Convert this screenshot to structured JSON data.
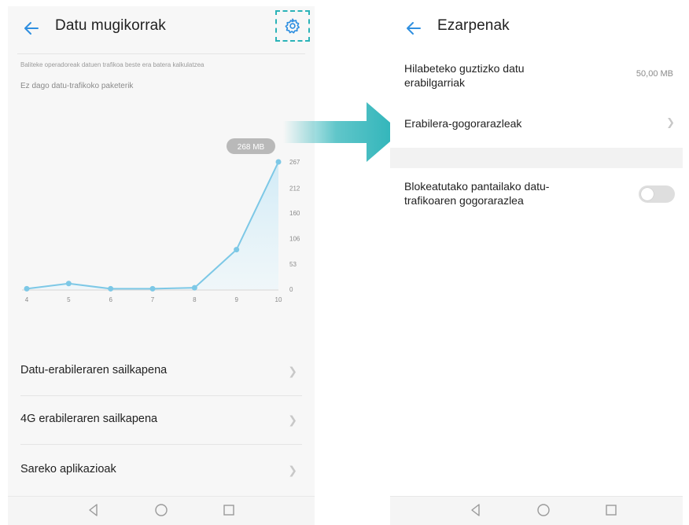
{
  "left": {
    "title": "Datu mugikorrak",
    "note_line1": "Baliteke operadoreak datuen trafikoa beste era batera kalkulatzea",
    "note_line2": "Ez dago datu-trafikoko paketerik",
    "usage_badge": "268 MB",
    "list": [
      {
        "label": "Datu-erabileraren sailkapena"
      },
      {
        "label": "4G erabileraren sailkapena"
      },
      {
        "label": "Sareko aplikazioak"
      }
    ]
  },
  "right": {
    "title": "Ezarpenak",
    "monthly_label": "Hilabeteko guztizko datu erabilgarriak",
    "monthly_value": "50,00 MB",
    "reminders_label": "Erabilera-gogorarazleak",
    "lockscreen_label": "Blokeatutako pantailako datu-trafikoaren gogorarazlea",
    "lockscreen_toggle": "off"
  },
  "colors": {
    "accent": "#2f8fe0",
    "chart_line": "#7dc8e6",
    "highlight": "#2bb3b8"
  },
  "icons": [
    "back-arrow-icon",
    "gear-icon",
    "chevron-right-icon",
    "nav-back-icon",
    "nav-home-icon",
    "nav-recents-icon"
  ],
  "chart_data": {
    "type": "area",
    "x": [
      "4",
      "5",
      "6",
      "7",
      "8",
      "9",
      "10"
    ],
    "series": [
      {
        "values": [
          1,
          12,
          1,
          1,
          3,
          83,
          267
        ]
      }
    ],
    "yticks": [
      "267",
      "212",
      "160",
      "106",
      "53",
      "0"
    ],
    "ylim": [
      0,
      267
    ],
    "y_axis_side": "right",
    "title": "",
    "xlabel": "",
    "ylabel": ""
  }
}
